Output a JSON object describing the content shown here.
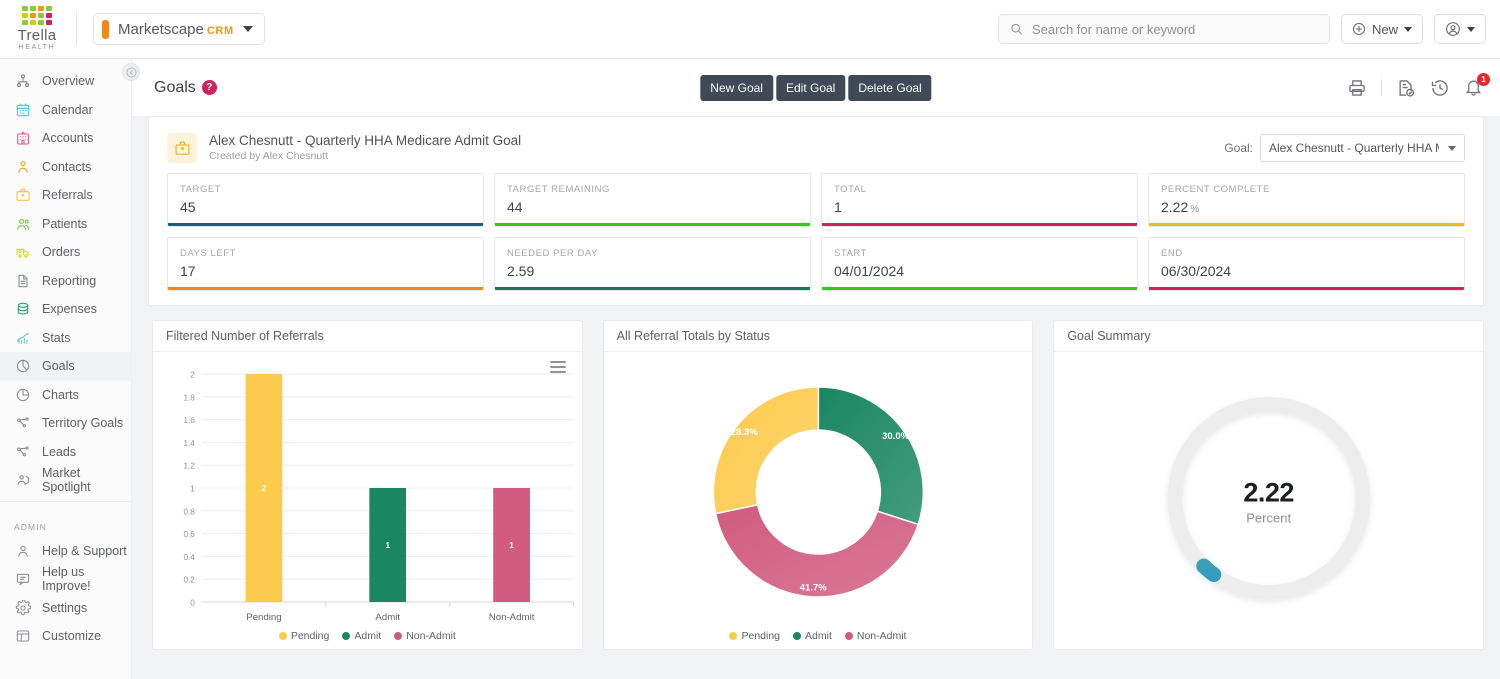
{
  "brand": {
    "name": "Trella",
    "sub": "HEALTH"
  },
  "app_switcher": {
    "name": "Marketscape",
    "suffix": "CRM"
  },
  "search": {
    "placeholder": "Search for name or keyword",
    "value": ""
  },
  "topbar": {
    "new_label": "New",
    "account_label": ""
  },
  "sidebar": {
    "items": [
      {
        "label": "Overview",
        "icon": "overview-icon",
        "color": "#7a8088"
      },
      {
        "label": "Calendar",
        "icon": "calendar-icon",
        "color": "#4ec3e0"
      },
      {
        "label": "Accounts",
        "icon": "accounts-icon",
        "color": "#e8557f"
      },
      {
        "label": "Contacts",
        "icon": "contacts-icon",
        "color": "#f5a623"
      },
      {
        "label": "Referrals",
        "icon": "referrals-icon",
        "color": "#f2c14e"
      },
      {
        "label": "Patients",
        "icon": "patients-icon",
        "color": "#7ac943"
      },
      {
        "label": "Orders",
        "icon": "orders-icon",
        "color": "#d9d51f"
      },
      {
        "label": "Reporting",
        "icon": "reporting-icon",
        "color": "#868c94"
      },
      {
        "label": "Expenses",
        "icon": "expenses-icon",
        "color": "#2e9e6b"
      },
      {
        "label": "Stats",
        "icon": "stats-icon",
        "color": "#63c4d8"
      },
      {
        "label": "Goals",
        "icon": "goals-icon",
        "color": "#868c94"
      },
      {
        "label": "Charts",
        "icon": "charts-icon",
        "color": "#868c94"
      },
      {
        "label": "Territory Goals",
        "icon": "territory-goals-icon",
        "color": "#868c94"
      },
      {
        "label": "Leads",
        "icon": "leads-icon",
        "color": "#868c94"
      },
      {
        "label": "Market Spotlight",
        "icon": "market-spotlight-icon",
        "color": "#868c94"
      }
    ],
    "admin_label": "ADMIN",
    "admin_items": [
      {
        "label": "Help & Support",
        "icon": "help-support-icon"
      },
      {
        "label": "Help us Improve!",
        "icon": "feedback-icon"
      },
      {
        "label": "Settings",
        "icon": "gear-icon"
      },
      {
        "label": "Customize",
        "icon": "customize-icon"
      }
    ]
  },
  "page": {
    "title": "Goals",
    "help_badge": "?",
    "buttons": [
      {
        "label": "New Goal",
        "name": "new-goal-button"
      },
      {
        "label": "Edit Goal",
        "name": "edit-goal-button"
      },
      {
        "label": "Delete Goal",
        "name": "delete-goal-button"
      }
    ],
    "notification_count": "1"
  },
  "goal": {
    "title": "Alex Chesnutt - Quarterly HHA Medicare Admit Goal",
    "created_by": "Created by Alex Chesnutt",
    "selector_label": "Goal:",
    "selected": "Alex Chesnutt - Quarterly HHA Medicare Admit Goal"
  },
  "kpis": [
    {
      "label": "TARGET",
      "value": "45",
      "unit": "",
      "color": "#15616d"
    },
    {
      "label": "TARGET REMAINING",
      "value": "44",
      "unit": "",
      "color": "#36c91e"
    },
    {
      "label": "TOTAL",
      "value": "1",
      "unit": "",
      "color": "#d4205c"
    },
    {
      "label": "PERCENT COMPLETE",
      "value": "2.22",
      "unit": "%",
      "color": "#f4b821"
    },
    {
      "label": "DAYS LEFT",
      "value": "17",
      "unit": "",
      "color": "#f5861f"
    },
    {
      "label": "NEEDED PER DAY",
      "value": "2.59",
      "unit": "",
      "color": "#10785c"
    },
    {
      "label": "START",
      "value": "04/01/2024",
      "unit": "",
      "color": "#36c91e"
    },
    {
      "label": "END",
      "value": "06/30/2024",
      "unit": "",
      "color": "#d4205c"
    }
  ],
  "chart_data": [
    {
      "type": "bar",
      "title": "Filtered Number of Referrals",
      "categories": [
        "Pending",
        "Admit",
        "Non-Admit"
      ],
      "values": [
        2,
        1,
        1
      ],
      "colors": [
        "#fcca4d",
        "#1a8662",
        "#d15b7f"
      ],
      "data_labels": [
        "2",
        "1",
        "1"
      ],
      "ylim": [
        0,
        2
      ],
      "yticks": [
        "0",
        "0.2",
        "0.4",
        "0.6",
        "0.8",
        "1",
        "1.2",
        "1.4",
        "1.6",
        "1.8",
        "2"
      ],
      "xlabel": "",
      "ylabel": "",
      "grid": true,
      "legend": [
        {
          "label": "Pending",
          "color": "#fcca4d"
        },
        {
          "label": "Admit",
          "color": "#1a8662"
        },
        {
          "label": "Non-Admit",
          "color": "#d15b7f"
        }
      ],
      "legend_position": "bottom",
      "menu_icon": "hamburger-menu-icon"
    },
    {
      "type": "pie",
      "title": "All Referral Totals by Status",
      "donut": true,
      "categories": [
        "Admit",
        "Non-Admit",
        "Pending"
      ],
      "values": [
        30.0,
        41.7,
        28.3
      ],
      "data_labels": [
        "30.0%",
        "41.7%",
        "28.3%"
      ],
      "colors": [
        "#1a8662",
        "#d15b7f",
        "#fcca4d"
      ],
      "legend": [
        {
          "label": "Pending",
          "color": "#fcca4d"
        },
        {
          "label": "Admit",
          "color": "#1a8662"
        },
        {
          "label": "Non-Admit",
          "color": "#d15b7f"
        }
      ],
      "legend_position": "bottom"
    },
    {
      "type": "gauge",
      "title": "Goal Summary",
      "value": 2.22,
      "value_label": "2.22",
      "unit_label": "Percent",
      "ylim": [
        0,
        100
      ],
      "track_color": "#ededee",
      "progress_colors": [
        "#79c14e",
        "#1f8fe0"
      ]
    }
  ]
}
